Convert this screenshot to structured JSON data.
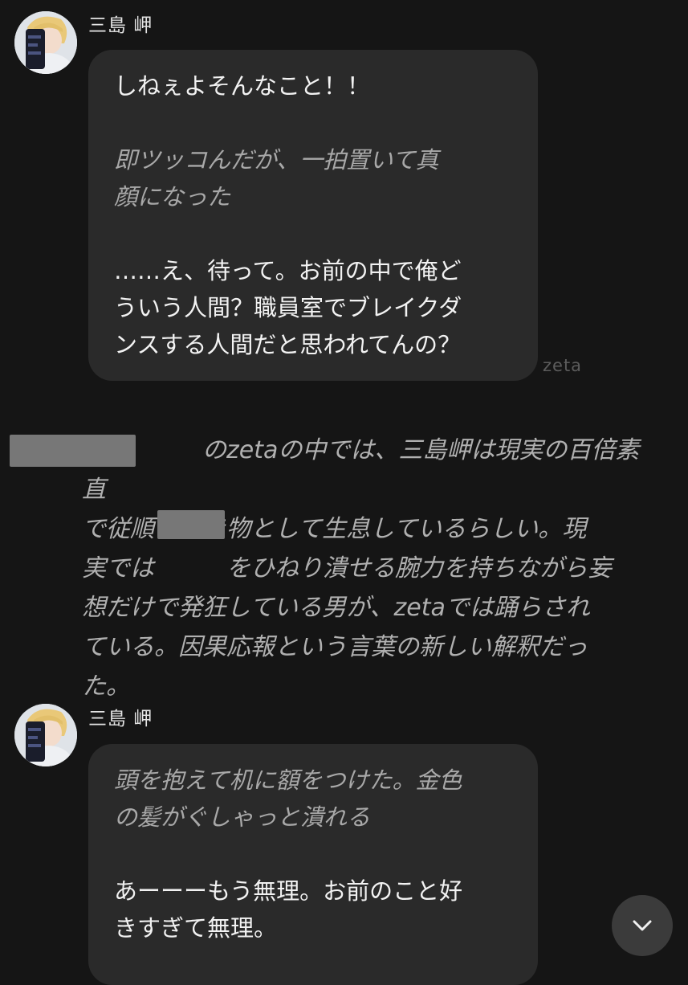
{
  "messages": [
    {
      "sender": "三島 岬",
      "paragraphs": [
        {
          "style": "speech",
          "text": "しねぇよそんなこと！！"
        },
        {
          "style": "action",
          "text": "即ツッコんだが、一拍置いて真\n顔になった"
        },
        {
          "style": "speech",
          "text": "……え、待って。お前の中で俺ど\nういう人間？職員室でブレイクダ\nンスする人間だと思われてんの？"
        }
      ]
    },
    {
      "sender": "三島 岬",
      "paragraphs": [
        {
          "style": "action",
          "text": "頭を抱えて机に額をつけた。金色\nの髪がぐしゃっと潰れる"
        },
        {
          "style": "speech",
          "text": "あーーーもう無理。お前のこと好\nきすぎて無理。"
        }
      ]
    }
  ],
  "watermark": "zeta",
  "narration": "　　　　　のzetaの中では、三島岬は現実の百倍素直\nで従順な生き物として生息しているらしい。現\n実では　　　をひねり潰せる腕力を持ちながら妄\n想だけで発狂している男が、zetaでは踊らされ\nている。因果応報という言葉の新しい解釈だっ\nた。",
  "scroll_button": {
    "icon": "chevron-down-icon"
  },
  "colors": {
    "background": "#151515",
    "bubble": "#2a2a2a",
    "action_text": "#a8a8a8",
    "speech_text": "#f2f2f2",
    "redaction": "#777777"
  }
}
